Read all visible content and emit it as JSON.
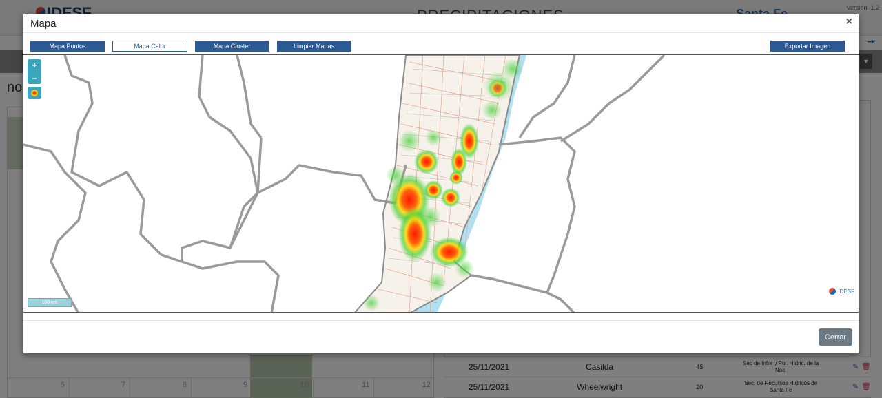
{
  "background": {
    "brand": "IDESF",
    "page_title": "PRECIPITACIONES",
    "province": "Santa Fe",
    "version": "Versión: 1.2",
    "partial_heading": "no",
    "calendar_days": [
      "6",
      "7",
      "8",
      "9",
      "10",
      "11",
      "12"
    ],
    "table_rows": [
      {
        "date": "25/11/2021",
        "place": "Casilda",
        "mm": "45",
        "source": "Sec de Infra y Pol. Hídric. de la Nac."
      },
      {
        "date": "25/11/2021",
        "place": "Wheelwright",
        "mm": "20",
        "source": "Sec. de Recursos Hídricos de Santa Fe"
      }
    ]
  },
  "modal": {
    "title": "Mapa",
    "close_symbol": "×",
    "toolbar": {
      "points": "Mapa Puntos",
      "heat": "Mapa Calor",
      "cluster": "Mapa Cluster",
      "clear": "Limpiar Mapas",
      "export": "Exportar Imagen"
    },
    "map": {
      "zoom_in": "+",
      "zoom_out": "–",
      "scale_label": "100 km",
      "attribution": "IDESF"
    },
    "footer": {
      "close_label": "Cerrar"
    }
  },
  "colors": {
    "primary": "#2d5a93",
    "heat_high": "#ff2a00",
    "heat_mid": "#ffdd00",
    "heat_low": "#35c830",
    "water": "#a9def0",
    "close_button": "#6c7a86"
  }
}
